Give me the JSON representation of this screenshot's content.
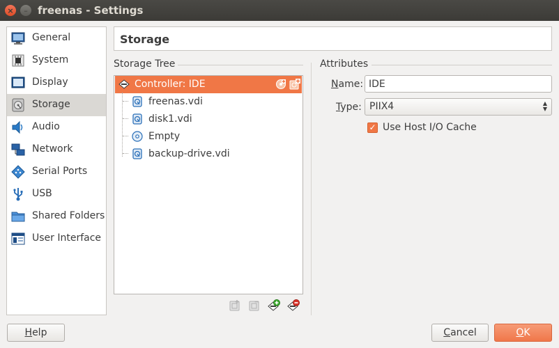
{
  "window": {
    "title": "freenas - Settings",
    "close_glyph": "×",
    "minimize_glyph": "–"
  },
  "sidebar": {
    "items": [
      {
        "label": "General",
        "icon": "monitor-icon"
      },
      {
        "label": "System",
        "icon": "chip-icon"
      },
      {
        "label": "Display",
        "icon": "display-icon"
      },
      {
        "label": "Storage",
        "icon": "disk-icon",
        "active": true
      },
      {
        "label": "Audio",
        "icon": "speaker-icon"
      },
      {
        "label": "Network",
        "icon": "network-icon"
      },
      {
        "label": "Serial Ports",
        "icon": "serial-port-icon"
      },
      {
        "label": "USB",
        "icon": "usb-icon"
      },
      {
        "label": "Shared Folders",
        "icon": "folder-icon"
      },
      {
        "label": "User Interface",
        "icon": "window-icon"
      }
    ]
  },
  "header": {
    "title": "Storage"
  },
  "storage_tree": {
    "label": "Storage Tree",
    "controller": {
      "label": "Controller: IDE",
      "icon": "ide-controller-icon"
    },
    "items": [
      {
        "label": "freenas.vdi",
        "icon": "hard-disk-icon"
      },
      {
        "label": "disk1.vdi",
        "icon": "hard-disk-icon"
      },
      {
        "label": "Empty",
        "icon": "optical-disc-icon"
      },
      {
        "label": "backup-drive.vdi",
        "icon": "hard-disk-icon"
      }
    ]
  },
  "attributes": {
    "label": "Attributes",
    "name_label_accel": "N",
    "name_label_rest": "ame:",
    "name_value": "IDE",
    "type_label_accel": "T",
    "type_label_rest": "ype:",
    "type_value": "PIIX4",
    "cache_label": "Use Host I/O Cache",
    "cache_checked": true,
    "check_glyph": "✓"
  },
  "buttons": {
    "help_accel": "H",
    "help_rest": "elp",
    "cancel_accel": "C",
    "cancel_rest": "ancel",
    "ok_accel": "O",
    "ok_rest": "K"
  },
  "colors": {
    "accent": "#f07746",
    "selection_text": "#ffffff",
    "titlebar": "#3c3b37"
  }
}
